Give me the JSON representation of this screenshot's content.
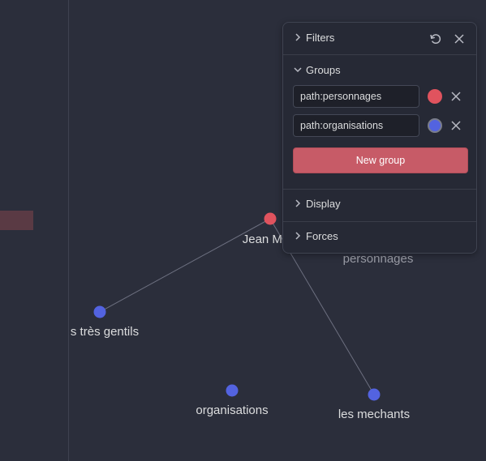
{
  "colors": {
    "background": "#2b2e3b",
    "panel": "#262935",
    "red_node": "#e0535e",
    "blue_node": "#5363e0",
    "edge": "#6d7080",
    "button": "#c75b67"
  },
  "graph": {
    "nodes": [
      {
        "label": "Jean Mi",
        "color": "red"
      },
      {
        "label": "s très gentils",
        "color": "blue"
      },
      {
        "label": "organisations",
        "color": "blue"
      },
      {
        "label": "les mechants",
        "color": "blue"
      },
      {
        "label": "personnages",
        "color": "none"
      }
    ]
  },
  "panel": {
    "filters_label": "Filters",
    "groups_label": "Groups",
    "groups": [
      {
        "query": "path:personnages",
        "color": "#e0535e"
      },
      {
        "query": "path:organisations",
        "color": "#5363e0"
      }
    ],
    "new_group_label": "New group",
    "display_label": "Display",
    "forces_label": "Forces",
    "icons": {
      "reset": "restore-icon",
      "close": "close-icon",
      "chevron_right": "chevron-right-icon",
      "chevron_down": "chevron-down-icon",
      "remove": "remove-icon"
    }
  }
}
